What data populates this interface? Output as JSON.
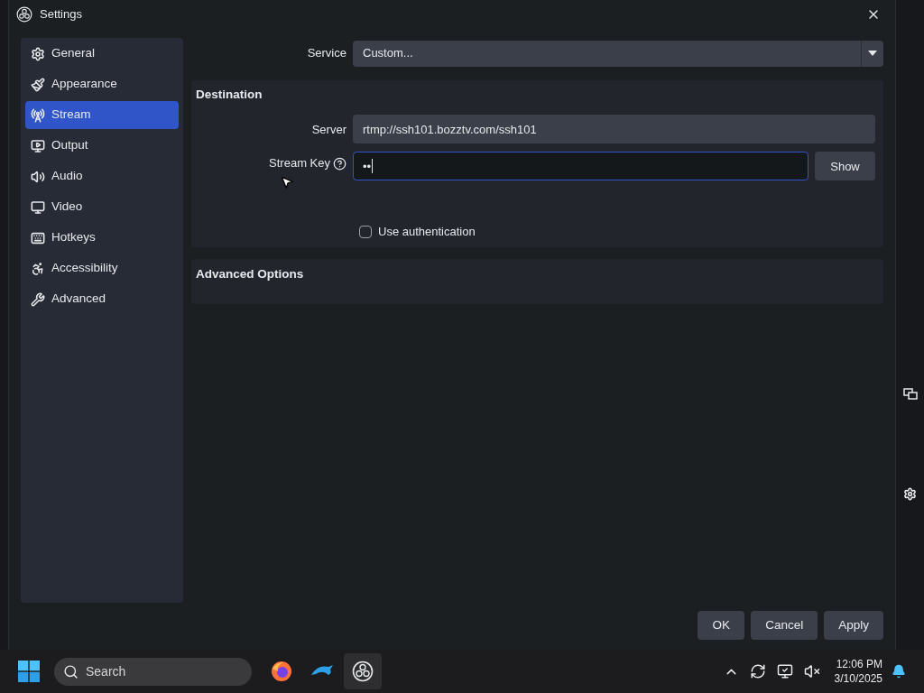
{
  "window": {
    "title": "Settings"
  },
  "sidebar": {
    "items": [
      {
        "label": "General",
        "selected": false
      },
      {
        "label": "Appearance",
        "selected": false
      },
      {
        "label": "Stream",
        "selected": true
      },
      {
        "label": "Output",
        "selected": false
      },
      {
        "label": "Audio",
        "selected": false
      },
      {
        "label": "Video",
        "selected": false
      },
      {
        "label": "Hotkeys",
        "selected": false
      },
      {
        "label": "Accessibility",
        "selected": false
      },
      {
        "label": "Advanced",
        "selected": false
      }
    ]
  },
  "service": {
    "label": "Service",
    "value": "Custom..."
  },
  "destination": {
    "title": "Destination",
    "server": {
      "label": "Server",
      "value": "rtmp://ssh101.bozztv.com/ssh101"
    },
    "stream_key": {
      "label": "Stream Key",
      "value": "••"
    },
    "show_button": "Show",
    "use_authentication": {
      "label": "Use authentication",
      "checked": false
    }
  },
  "advanced_options": {
    "title": "Advanced Options"
  },
  "buttons": [
    "OK",
    "Cancel",
    "Apply"
  ],
  "taskbar": {
    "search_placeholder": "Search",
    "time": "12:06 PM",
    "date": "3/10/2025"
  }
}
